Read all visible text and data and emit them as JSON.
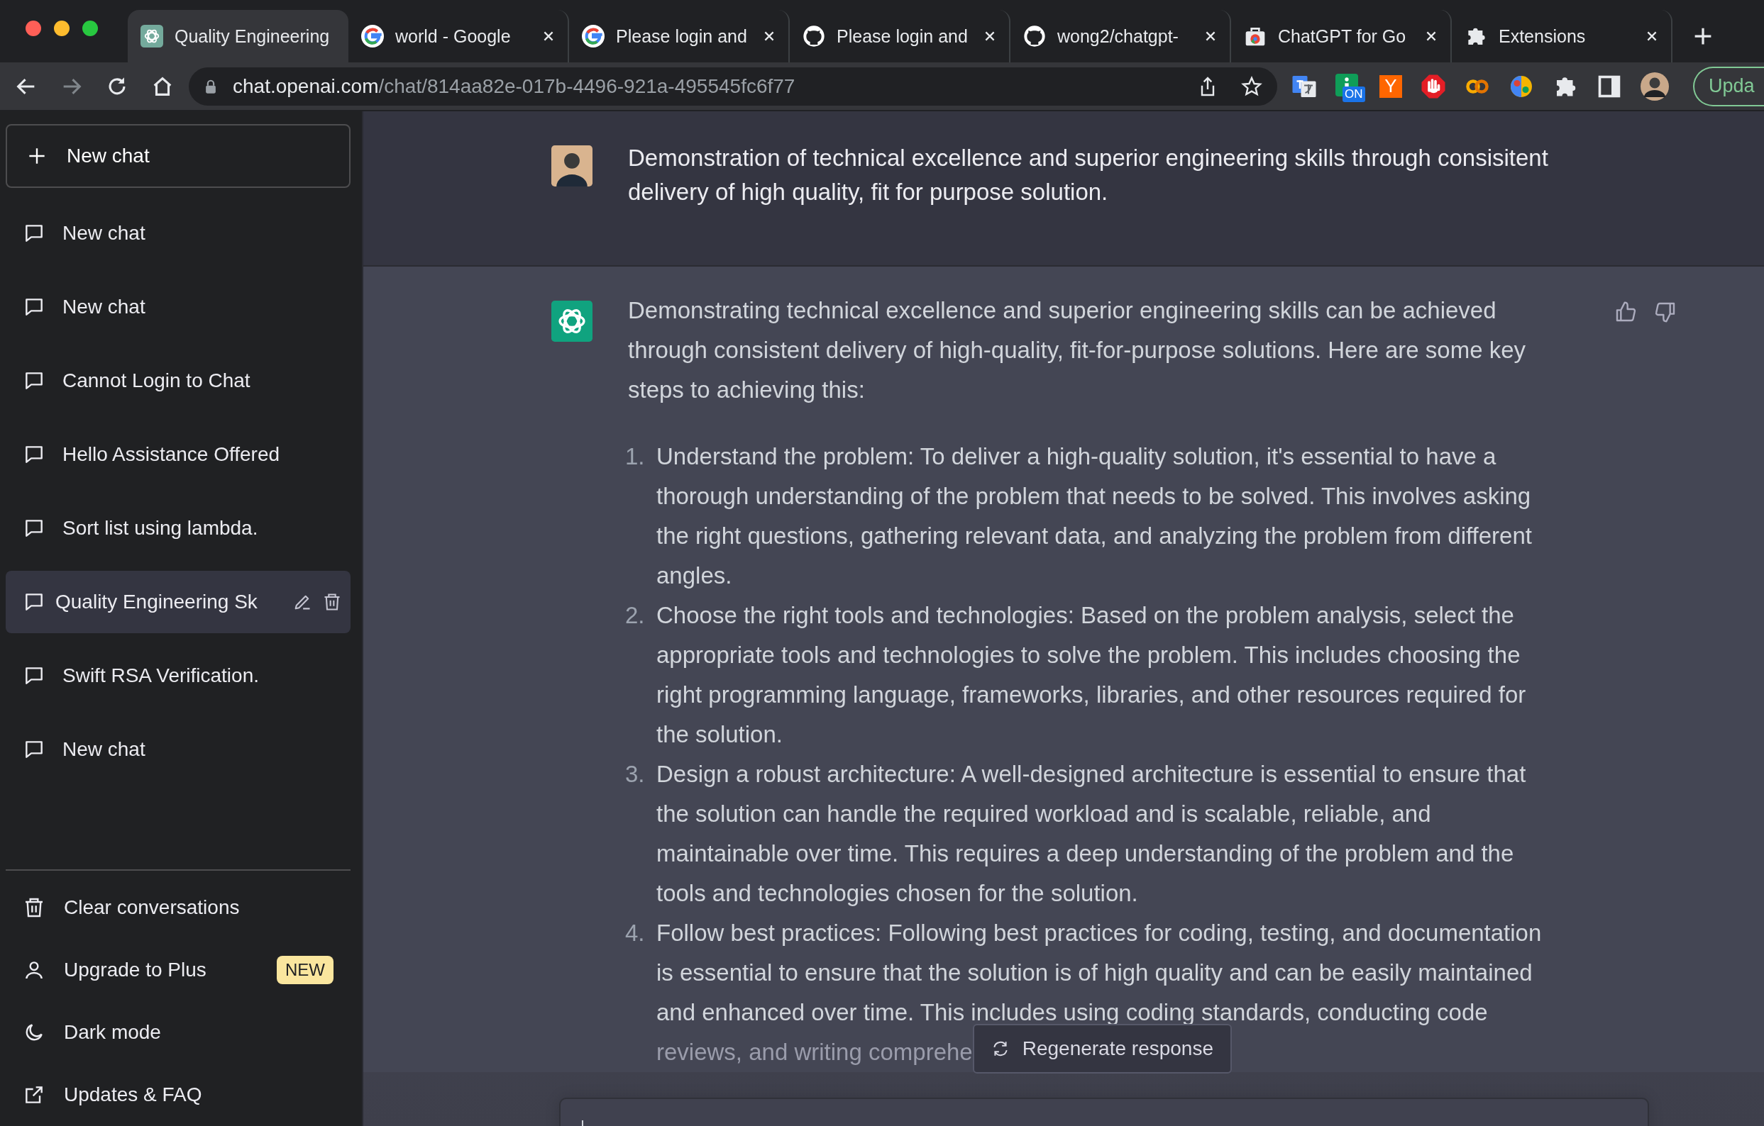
{
  "browser": {
    "tabs": [
      {
        "kind": "openai",
        "title": "Quality Engineering",
        "selected": true
      },
      {
        "kind": "google",
        "title": "world - Google",
        "selected": false
      },
      {
        "kind": "google",
        "title": "Please login and",
        "selected": false
      },
      {
        "kind": "github",
        "title": "Please login and",
        "selected": false
      },
      {
        "kind": "github",
        "title": "wong2/chatgpt-",
        "selected": false
      },
      {
        "kind": "store",
        "title": "ChatGPT for Go",
        "selected": false
      },
      {
        "kind": "puzzle",
        "title": "Extensions",
        "selected": false
      }
    ],
    "url": {
      "host": "chat.openai.com",
      "path": "/chat/814aa82e-017b-4496-921a-495545fc6f77"
    },
    "extensions": [
      {
        "kind": "translate"
      },
      {
        "kind": "info",
        "badge": "ON"
      },
      {
        "kind": "letter",
        "label": "Y"
      },
      {
        "kind": "stop"
      },
      {
        "kind": "rings"
      },
      {
        "kind": "brain"
      },
      {
        "kind": "puzzle"
      },
      {
        "kind": "sidepanel"
      },
      {
        "kind": "avatar"
      }
    ],
    "update_button": "Upda"
  },
  "sidebar": {
    "new_chat_button": "New chat",
    "conversations": [
      {
        "title": "New chat",
        "selected": false
      },
      {
        "title": "New chat",
        "selected": false
      },
      {
        "title": "Cannot Login to Chat",
        "selected": false
      },
      {
        "title": "Hello Assistance Offered",
        "selected": false
      },
      {
        "title": "Sort list using lambda.",
        "selected": false
      },
      {
        "title": "Quality Engineering Sk",
        "selected": true
      },
      {
        "title": "Swift RSA Verification.",
        "selected": false
      },
      {
        "title": "New chat",
        "selected": false
      }
    ],
    "menu": [
      {
        "kind": "trash",
        "label": "Clear conversations"
      },
      {
        "kind": "user",
        "label": "Upgrade to Plus",
        "badge": "NEW"
      },
      {
        "kind": "moon",
        "label": "Dark mode"
      },
      {
        "kind": "external",
        "label": "Updates & FAQ"
      }
    ]
  },
  "chat": {
    "messages": [
      {
        "kind": "user",
        "text": "Demonstration of technical excellence and superior engineering skills through consisitent delivery of high quality, fit for purpose solution."
      },
      {
        "kind": "assistant",
        "intro": "Demonstrating technical excellence and superior engineering skills can be achieved through consistent delivery of high-quality, fit-for-purpose solutions. Here are some key steps to achieving this:",
        "list": [
          {
            "number": "1.",
            "text": "Understand the problem: To deliver a high-quality solution, it's essential to have a thorough understanding of the problem that needs to be solved. This involves asking the right questions, gathering relevant data, and analyzing the problem from different angles."
          },
          {
            "number": "2.",
            "text": "Choose the right tools and technologies: Based on the problem analysis, select the appropriate tools and technologies to solve the problem. This includes choosing the right programming language, frameworks, libraries, and other resources required for the solution."
          },
          {
            "number": "3.",
            "text": "Design a robust architecture: A well-designed architecture is essential to ensure that the solution can handle the required workload and is scalable, reliable, and maintainable over time. This requires a deep understanding of the problem and the tools and technologies chosen for the solution."
          },
          {
            "number": "4.",
            "text": "Follow best practices: Following best practices for coding, testing, and documentation is essential to ensure that the solution is of high quality and can be easily maintained and enhanced over time. This includes using coding standards, conducting code",
            "last_line": "reviews, and writing comprehe"
          }
        ]
      }
    ],
    "regenerate_button": "Regenerate response"
  }
}
